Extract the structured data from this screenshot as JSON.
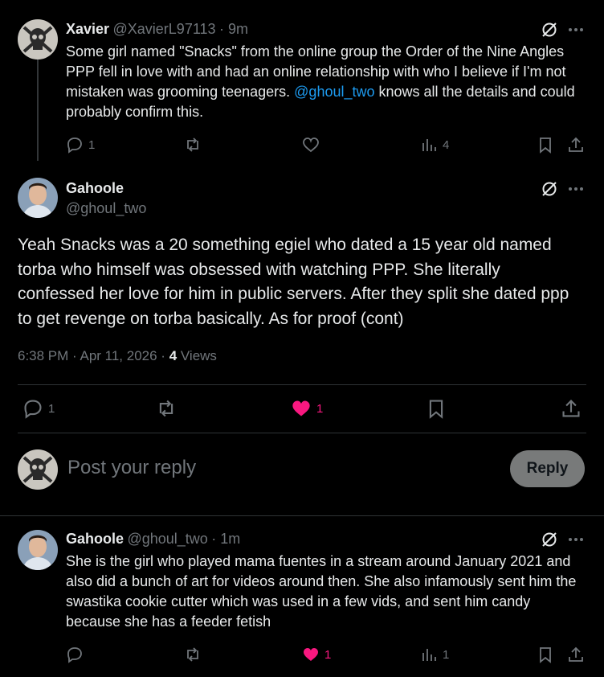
{
  "tweet1": {
    "name": "Xavier",
    "handle": "@XavierL97113",
    "time": "· 9m",
    "text_before": "Some girl named \"Snacks\" from the online group the Order of the Nine Angles PPP fell in love with and had an  online relationship with who I believe if I'm not mistaken was grooming teenagers. ",
    "mention": "@ghoul_two",
    "text_after": " knows all the details and could probably confirm this.",
    "replies": "1",
    "views": "4"
  },
  "tweet2": {
    "name": "Gahoole",
    "handle": "@ghoul_two",
    "text": "Yeah Snacks was a 20 something egiel who dated a 15 year old named torba who himself was obsessed with watching PPP. She literally confessed her love for him in public servers. After they split she dated ppp to get revenge on torba basically. As for proof (cont)",
    "timestamp": "6:38 PM · Apr 11, 2026 · ",
    "views_count": "4",
    "views_label": " Views",
    "replies": "1",
    "likes": "1"
  },
  "composer": {
    "placeholder": "Post your reply",
    "reply_label": "Reply"
  },
  "tweet3": {
    "name": "Gahoole",
    "handle": "@ghoul_two",
    "time": "· 1m",
    "text": "She is the girl who played mama fuentes in a stream around January 2021 and also did a bunch of art for videos around then. She also infamously sent him the swastika cookie cutter which was used in a few vids, and sent him candy because she has a feeder fetish",
    "likes": "1",
    "views": "1"
  },
  "colors": {
    "background": "#000000",
    "text": "#e7e9ea",
    "muted": "#71767b",
    "mention": "#1d9bf0",
    "like": "#f91880"
  }
}
